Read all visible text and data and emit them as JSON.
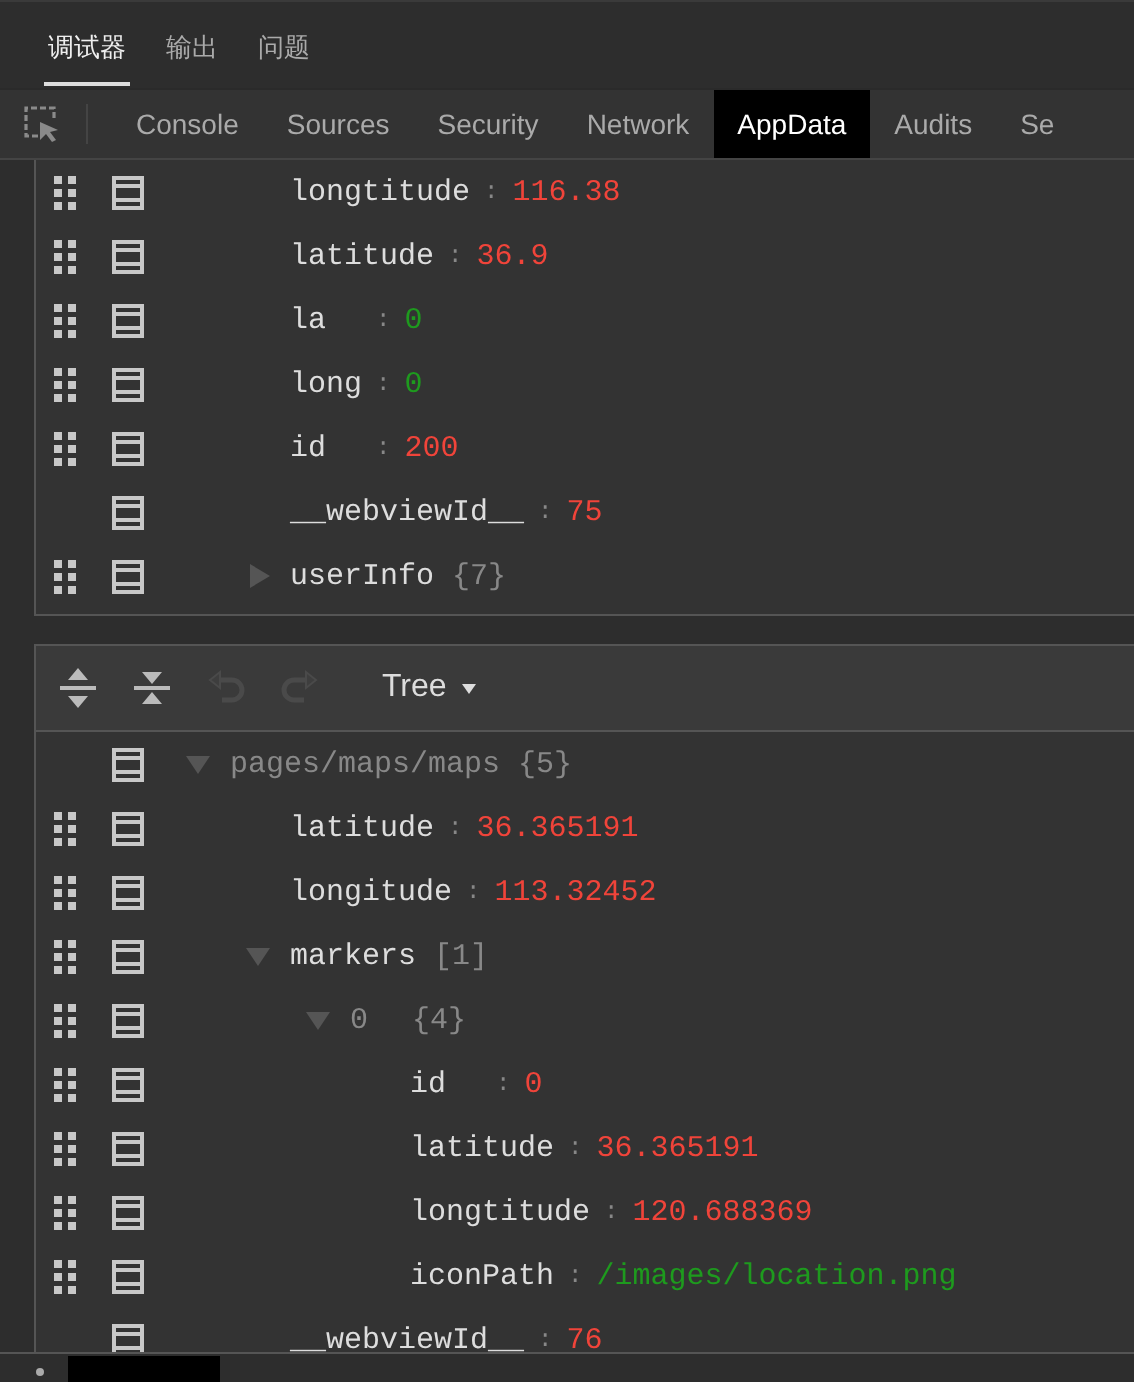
{
  "top_tabs": [
    {
      "label": "调试器",
      "selected": true
    },
    {
      "label": "输出",
      "selected": false
    },
    {
      "label": "问题",
      "selected": false
    }
  ],
  "devtools_tabs": [
    {
      "label": "Console",
      "selected": false
    },
    {
      "label": "Sources",
      "selected": false
    },
    {
      "label": "Security",
      "selected": false
    },
    {
      "label": "Network",
      "selected": false
    },
    {
      "label": "AppData",
      "selected": true
    },
    {
      "label": "Audits",
      "selected": false
    },
    {
      "label": "Se",
      "selected": false
    }
  ],
  "upper_panel": {
    "rows": [
      {
        "key": "longtitude",
        "sep": ":",
        "value": "116.38",
        "kind": "number",
        "handle": true
      },
      {
        "key": "latitude",
        "sep": ":",
        "value": "36.9",
        "kind": "number",
        "handle": true
      },
      {
        "key": "la",
        "sep": ":",
        "value": "0",
        "kind": "text",
        "handle": true
      },
      {
        "key": "long",
        "sep": ":",
        "value": "0",
        "kind": "text",
        "handle": true
      },
      {
        "key": "id",
        "sep": ":",
        "value": "200",
        "kind": "number",
        "handle": true
      },
      {
        "key": "__webviewId__",
        "sep": ":",
        "value": "75",
        "kind": "number",
        "handle": false
      },
      {
        "key": "userInfo",
        "count": "{7}",
        "kind": "object",
        "expanded": false,
        "handle": true
      }
    ]
  },
  "lower_panel": {
    "view_mode": "Tree",
    "rows": [
      {
        "key": "pages/maps/maps",
        "count": "{5}",
        "kind": "root",
        "expanded": true,
        "handle": false,
        "children": [
          {
            "key": "latitude",
            "sep": ":",
            "value": "36.365191",
            "kind": "number",
            "handle": true
          },
          {
            "key": "longitude",
            "sep": ":",
            "value": "113.32452",
            "kind": "number",
            "handle": true
          },
          {
            "key": "markers",
            "count": "[1]",
            "kind": "object",
            "expanded": true,
            "handle": true,
            "children": [
              {
                "key": "0",
                "count": "{4}",
                "kind": "index",
                "expanded": true,
                "handle": true,
                "children": [
                  {
                    "key": "id",
                    "sep": ":",
                    "value": "0",
                    "kind": "number",
                    "handle": true
                  },
                  {
                    "key": "latitude",
                    "sep": ":",
                    "value": "36.365191",
                    "kind": "number",
                    "handle": true
                  },
                  {
                    "key": "longtitude",
                    "sep": ":",
                    "value": "120.688369",
                    "kind": "number",
                    "handle": true
                  },
                  {
                    "key": "iconPath",
                    "sep": ":",
                    "value": "/images/location.png",
                    "kind": "text",
                    "handle": true
                  }
                ]
              }
            ]
          },
          {
            "key": "__webviewId__",
            "sep": ":",
            "value": "76",
            "kind": "number",
            "handle": false
          }
        ]
      }
    ]
  }
}
